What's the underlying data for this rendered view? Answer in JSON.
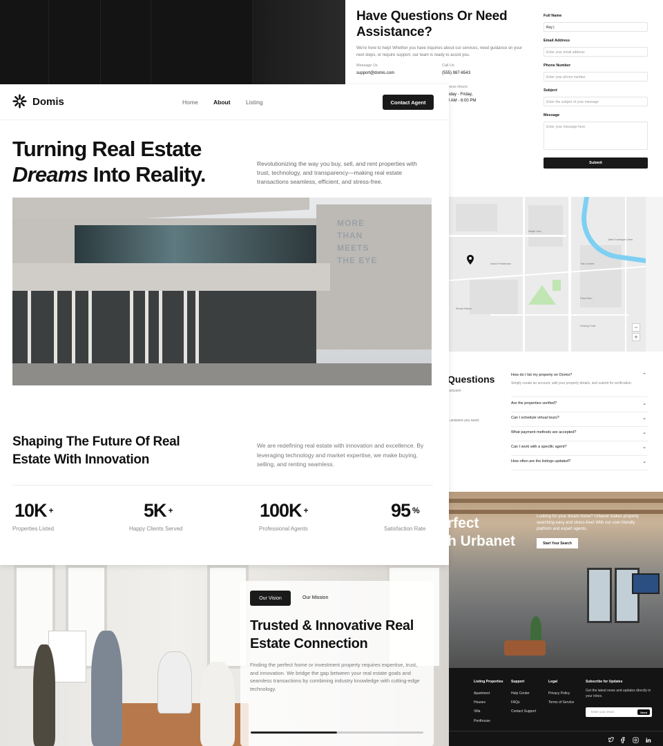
{
  "nav": {
    "brand": "Domis",
    "links": [
      "Home",
      "About",
      "Listing"
    ],
    "active": "About",
    "cta": "Contact Agent"
  },
  "hero": {
    "line1": "Turning Real Estate",
    "line2_em": "Dreams",
    "line2_rest": " Into Reality.",
    "description": "Revolutionizing the way you buy, sell, and rent properties with trust, technology, and transparency—making real estate transactions seamless, efficient, and stress-free.",
    "image_sign": "MORE THAN MEETS THE EYE"
  },
  "section2": {
    "title": "Shaping The Future Of Real Estate With Innovation",
    "description": "We are redefining real estate with innovation and excellence. By leveraging technology and market expertise, we make buying, selling, and renting seamless."
  },
  "stats": [
    {
      "value": "10K",
      "suffix": "+",
      "label": "Properties Listed"
    },
    {
      "value": "5K",
      "suffix": "+",
      "label": "Happy Clients Served"
    },
    {
      "value": "100K",
      "suffix": "+",
      "label": "Professional Agents"
    },
    {
      "value": "95",
      "suffix": "%",
      "label": "Satisfaction Rate"
    }
  ],
  "vision": {
    "tabs": [
      "Our Vision",
      "Our Mission"
    ],
    "title": "Trusted & Innovative Real Estate Connection",
    "description": "Finding the perfect home or investment property requires expertise, trust, and innovation. We bridge the gap between your real estate goals and seamless transactions by combining industry knowledge with cutting-edge technology.",
    "progress": 0.5
  },
  "contact": {
    "title": "Have Questions Or Need Assistance?",
    "intro": "We're here to help! Whether you have inquiries about our services, need guidance on your next steps, or require support, our team is ready to assist you.",
    "message_label": "Message Us",
    "email": "support@domis.com",
    "call_label": "Call Us",
    "phone": "(555) 987-6543",
    "hours_label": "iness Hours",
    "hours_days": "eday - Friday,",
    "hours_time": "0 AM - 6:00 PM",
    "form": {
      "full_name_label": "Full Name",
      "full_name_value": "Roy |",
      "email_label": "Email Address",
      "email_placeholder": "Enter your email address",
      "phone_label": "Phone Number",
      "phone_placeholder": "Enter your phone number",
      "subject_label": "Subject",
      "subject_placeholder": "Enter the subject of your message",
      "message_label": "Message",
      "message_placeholder": "Enter your message here",
      "submit": "Submit"
    }
  },
  "map": {
    "labels": [
      "Jalan Kumangan Utara",
      "Masjid Jami",
      "Kantor Perkebunan",
      "Toko Sumber",
      "Pasar Baru",
      "Rumah Makan",
      "Gedung Pusat"
    ],
    "zoom_in": "+",
    "zoom_out": "−"
  },
  "faq": {
    "title": "Questions",
    "sub1": "concern",
    "sub2": "e answers you need.",
    "items": [
      {
        "q": "How do I list my property on Domis?",
        "a": "Simply create an account, add your property details, and submit for verification."
      },
      {
        "q": "Are the properties verified?"
      },
      {
        "q": "Can I schedule virtual tours?"
      },
      {
        "q": "What payment methods are accepted?"
      },
      {
        "q": "Can I work with a specific agent?"
      },
      {
        "q": "How often are the listings updated?"
      }
    ]
  },
  "banner": {
    "head1": "rfect",
    "head2": "h Urbanet",
    "text": "Looking for your dream home? Urbanet makes property searching easy and stress-free! With our user-friendly platform and expert agents,",
    "button": "Start Your Search"
  },
  "footer": {
    "col1_title": "Listing Properties",
    "col1": [
      "Apartment",
      "Houses",
      "Villa",
      "Penthouse"
    ],
    "col2_title": "Support",
    "col2": [
      "Help Center",
      "FAQs",
      "Contact Support"
    ],
    "col3_title": "Legal",
    "col3": [
      "Privacy Policy",
      "Terms of Service"
    ],
    "col4_title": "Subscribe for Updates",
    "subscribe_text": "Get the latest news and updates directly in your inbox.",
    "email_placeholder": "Enter your email",
    "send": "Send",
    "social": [
      "twitter-icon",
      "facebook-icon",
      "instagram-icon",
      "linkedin-icon"
    ]
  }
}
